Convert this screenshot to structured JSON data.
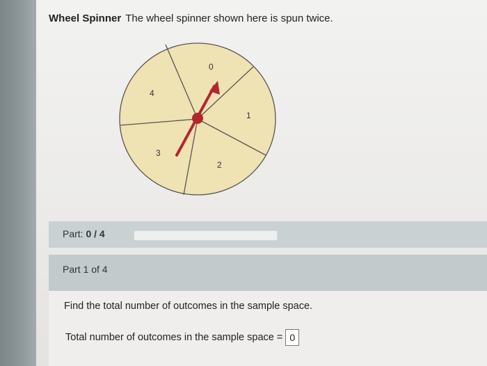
{
  "question": {
    "title": "Wheel Spinner",
    "text": "The wheel spinner shown here is spun twice."
  },
  "wheel": {
    "sector_labels": [
      "0",
      "1",
      "2",
      "3",
      "4"
    ],
    "fill_color": "#efe2b3",
    "line_color": "#555555",
    "arrow_color": "#b3262e"
  },
  "part": {
    "label": "Part:",
    "value": "0 / 4",
    "progress_fraction": 0
  },
  "section": {
    "header": "Part 1 of 4"
  },
  "task": {
    "instruction": "Find the total number of outcomes in the sample space.",
    "answer_label": "Total number of outcomes in the sample space",
    "equals": "=",
    "answer_value": "0"
  }
}
